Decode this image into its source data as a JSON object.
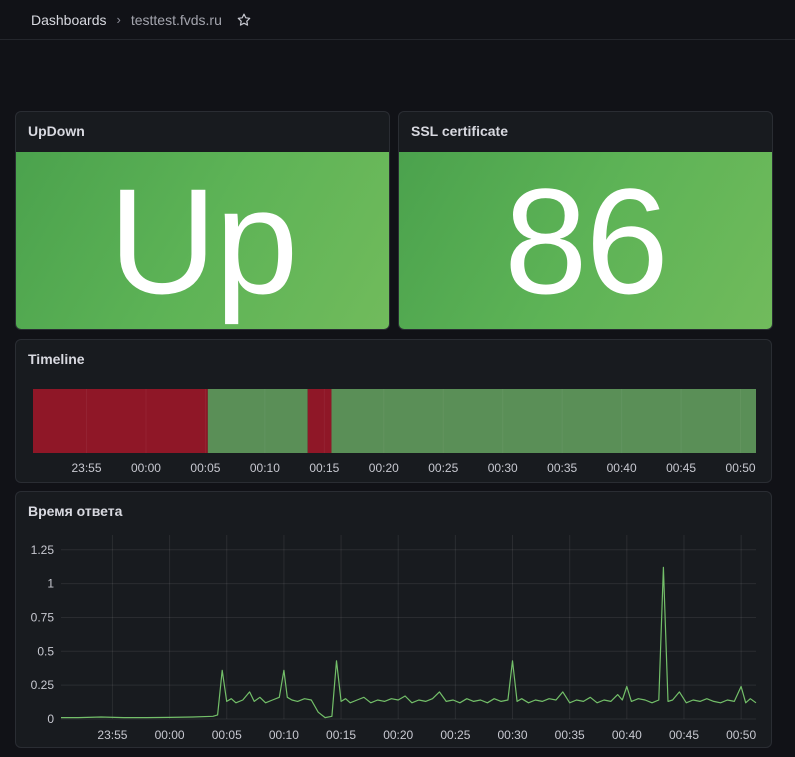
{
  "breadcrumb": {
    "root": "Dashboards",
    "separator": "›",
    "current": "testtest.fvds.ru"
  },
  "icons": {
    "favorite": "star-icon"
  },
  "panels": {
    "updown": {
      "title": "UpDown",
      "value": "Up",
      "color": "#56a64b"
    },
    "ssl": {
      "title": "SSL certificate",
      "value": "86",
      "color": "#56a64b"
    },
    "timeline": {
      "title": "Timeline"
    },
    "response": {
      "title": "Время ответа"
    }
  },
  "chart_data": [
    {
      "type": "state-timeline",
      "title": "Timeline",
      "x_ticks": [
        "23:55",
        "00:00",
        "00:05",
        "00:10",
        "00:15",
        "00:20",
        "00:25",
        "00:30",
        "00:35",
        "00:40",
        "00:45",
        "00:50"
      ],
      "segments": [
        {
          "state": "Down",
          "color": "#8f1727",
          "start": "23:50.5",
          "end": "00:05.2"
        },
        {
          "state": "Up",
          "color": "#5a8f57",
          "start": "00:05.2",
          "end": "00:13.6"
        },
        {
          "state": "Down",
          "color": "#8f1727",
          "start": "00:13.6",
          "end": "00:15.6"
        },
        {
          "state": "Up",
          "color": "#5a8f57",
          "start": "00:15.6",
          "end": "00:51.3"
        }
      ]
    },
    {
      "type": "line",
      "title": "Время ответа",
      "color": "#73bf69",
      "x_ticks": [
        "23:55",
        "00:00",
        "00:05",
        "00:10",
        "00:15",
        "00:20",
        "00:25",
        "00:30",
        "00:35",
        "00:40",
        "00:45",
        "00:50"
      ],
      "y_ticks": [
        "0",
        "0.25",
        "0.5",
        "0.75",
        "1",
        "1.25"
      ],
      "ylim": [
        0,
        1.3
      ],
      "x_range_minutes": [
        -9.5,
        51.3
      ],
      "series": [
        {
          "x": [
            -9.5,
            -8,
            -6,
            -4,
            -2,
            0,
            2,
            3.8,
            4.2,
            4.6,
            5,
            5.4,
            5.8,
            6.4,
            7,
            7.4,
            7.9,
            8.4,
            9,
            9.6,
            10,
            10.3,
            10.7,
            11.2,
            11.8,
            12.4,
            13,
            13.6,
            14.2,
            14.6,
            15,
            15.4,
            15.8,
            16.4,
            17,
            17.6,
            18.2,
            18.8,
            19.4,
            20,
            20.6,
            21.2,
            21.8,
            22.4,
            23,
            23.6,
            24.2,
            24.8,
            25.4,
            26,
            26.6,
            27.2,
            27.8,
            28.4,
            29,
            29.6,
            30,
            30.4,
            30.8,
            31.4,
            32,
            32.6,
            33.2,
            33.8,
            34.4,
            35,
            35.6,
            36.2,
            36.8,
            37.4,
            38,
            38.6,
            39.2,
            39.6,
            40,
            40.4,
            41,
            41.6,
            42.2,
            42.8,
            43.2,
            43.6,
            44,
            44.6,
            45.2,
            45.8,
            46.4,
            47,
            47.6,
            48.2,
            48.8,
            49.4,
            50,
            50.4,
            50.8,
            51.3
          ],
          "y": [
            0.01,
            0.01,
            0.015,
            0.01,
            0.01,
            0.012,
            0.015,
            0.02,
            0.03,
            0.36,
            0.13,
            0.15,
            0.12,
            0.14,
            0.2,
            0.13,
            0.16,
            0.12,
            0.14,
            0.16,
            0.36,
            0.16,
            0.14,
            0.13,
            0.15,
            0.14,
            0.05,
            0.01,
            0.02,
            0.43,
            0.13,
            0.15,
            0.12,
            0.14,
            0.16,
            0.12,
            0.14,
            0.13,
            0.15,
            0.14,
            0.17,
            0.12,
            0.14,
            0.13,
            0.15,
            0.2,
            0.13,
            0.14,
            0.12,
            0.15,
            0.13,
            0.14,
            0.12,
            0.15,
            0.13,
            0.14,
            0.43,
            0.13,
            0.15,
            0.12,
            0.14,
            0.13,
            0.15,
            0.14,
            0.2,
            0.12,
            0.14,
            0.13,
            0.16,
            0.12,
            0.14,
            0.13,
            0.18,
            0.14,
            0.24,
            0.13,
            0.15,
            0.14,
            0.12,
            0.14,
            1.12,
            0.13,
            0.14,
            0.2,
            0.12,
            0.14,
            0.13,
            0.15,
            0.13,
            0.12,
            0.14,
            0.13,
            0.24,
            0.12,
            0.15,
            0.12
          ]
        }
      ]
    }
  ]
}
